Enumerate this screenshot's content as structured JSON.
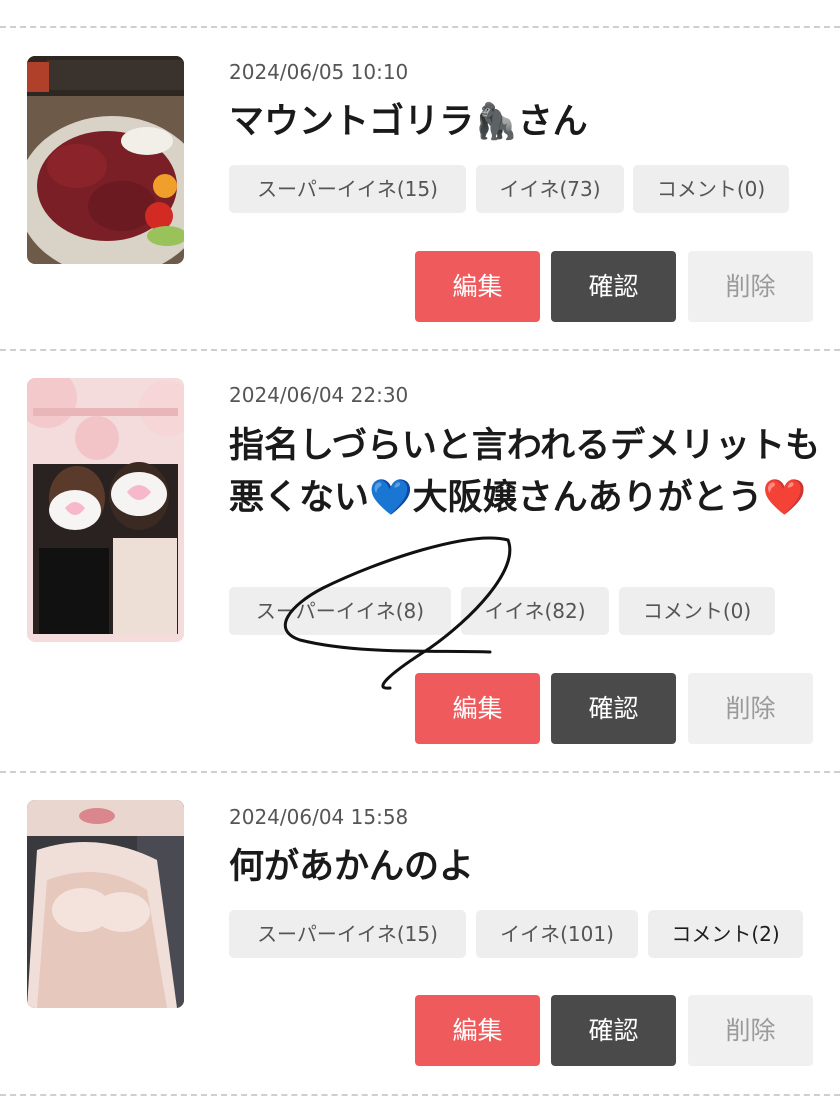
{
  "posts": [
    {
      "date": "2024/06/05 10:10",
      "title": "マウントゴリラ🦍さん",
      "stats": {
        "super_like": "スーパーイイネ(15)",
        "like": "イイネ(73)",
        "comment": "コメント(0)"
      },
      "actions": {
        "edit": "編集",
        "confirm": "確認",
        "delete": "削除"
      }
    },
    {
      "date": "2024/06/04 22:30",
      "title": "指名しづらいと言われるデメリットも悪くない💙大阪嬢さんありがとう❤️",
      "stats": {
        "super_like": "スーパーイイネ(8)",
        "like": "イイネ(82)",
        "comment": "コメント(0)"
      },
      "actions": {
        "edit": "編集",
        "confirm": "確認",
        "delete": "削除"
      }
    },
    {
      "date": "2024/06/04 15:58",
      "title": "何があかんのよ",
      "stats": {
        "super_like": "スーパーイイネ(15)",
        "like": "イイネ(101)",
        "comment": "コメント(2)"
      },
      "actions": {
        "edit": "編集",
        "confirm": "確認",
        "delete": "削除"
      }
    }
  ],
  "colors": {
    "edit_button": "#ef5a5d",
    "confirm_button": "#4a4a4a",
    "delete_button": "#f0f0f0",
    "chip_background": "#eeeeee",
    "divider": "#cfcfcf"
  }
}
